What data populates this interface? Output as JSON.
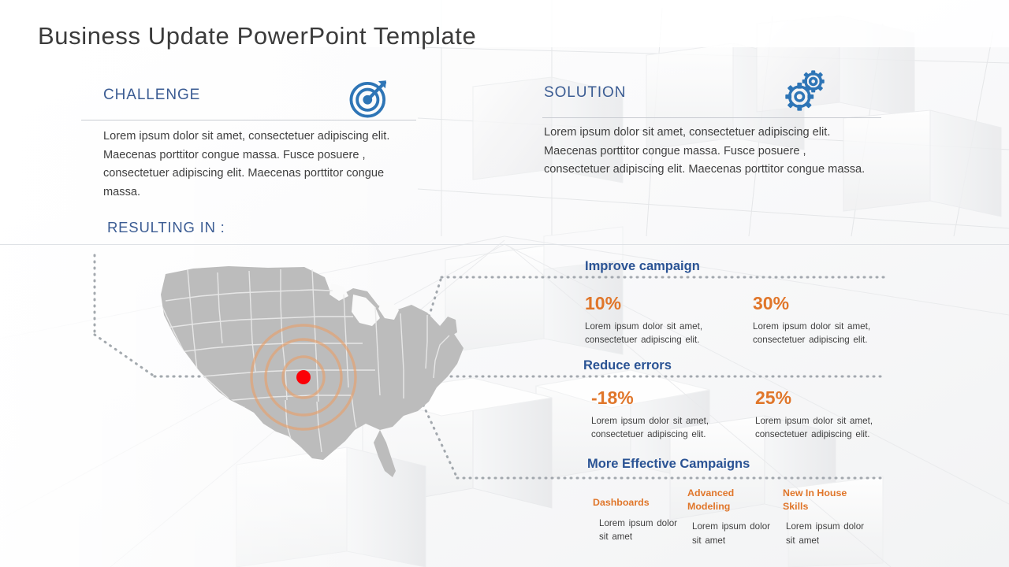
{
  "slide": {
    "title": "Business Update PowerPoint Template",
    "resulting_in_label": "RESULTING IN :"
  },
  "colors": {
    "heading_blue": "#3b5c93",
    "result_blue": "#2a5394",
    "accent_orange": "#e0762a",
    "icon_blue": "#2e75b6",
    "map_gray": "#bcbcbc",
    "marker_red": "#fb0007",
    "ripple_orange": "#e8a06a",
    "rule_gray": "#c9ccd2",
    "dot_gray": "#9aa0a6"
  },
  "panels": [
    {
      "id": "challenge",
      "title": "CHALLENGE",
      "icon": "target-icon",
      "body": "Lorem ipsum dolor sit amet, consectetuer adipiscing elit. Maecenas porttitor congue massa. Fusce posuere , consectetuer adipiscing elit. Maecenas porttitor congue massa."
    },
    {
      "id": "solution",
      "title": "SOLUTION",
      "icon": "gears-icon",
      "body": "Lorem ipsum dolor sit amet, consectetuer adipiscing elit. Maecenas porttitor congue massa. Fusce posuere , consectetuer adipiscing elit. Maecenas porttitor congue massa."
    }
  ],
  "results": [
    {
      "id": "improve-campaign",
      "heading": "Improve campaign",
      "stats": [
        {
          "value": "10%",
          "desc": "Lorem  ipsum dolor sit amet, consectetuer  adipiscing elit."
        },
        {
          "value": "30%",
          "desc": "Lorem  ipsum dolor sit amet, consectetuer  adipiscing elit."
        }
      ]
    },
    {
      "id": "reduce-errors",
      "heading": "Reduce errors",
      "stats": [
        {
          "value": "-18%",
          "desc": "Lorem  ipsum dolor sit amet, consectetuer  adipiscing elit."
        },
        {
          "value": "25%",
          "desc": "Lorem  ipsum dolor sit amet, consectetuer  adipiscing elit."
        }
      ]
    },
    {
      "id": "more-effective-campaigns",
      "heading": "More Effective Campaigns",
      "minis": [
        {
          "title": "Dashboards",
          "desc": "Lorem  ipsum dolor sit amet"
        },
        {
          "title": "Advanced Modeling",
          "desc": "Lorem  ipsum dolor sit amet"
        },
        {
          "title": "New In House Skills",
          "desc": "Lorem  ipsum dolor sit amet"
        }
      ]
    }
  ],
  "map": {
    "region_label": "united-states-map",
    "marker_label": "location-marker"
  }
}
